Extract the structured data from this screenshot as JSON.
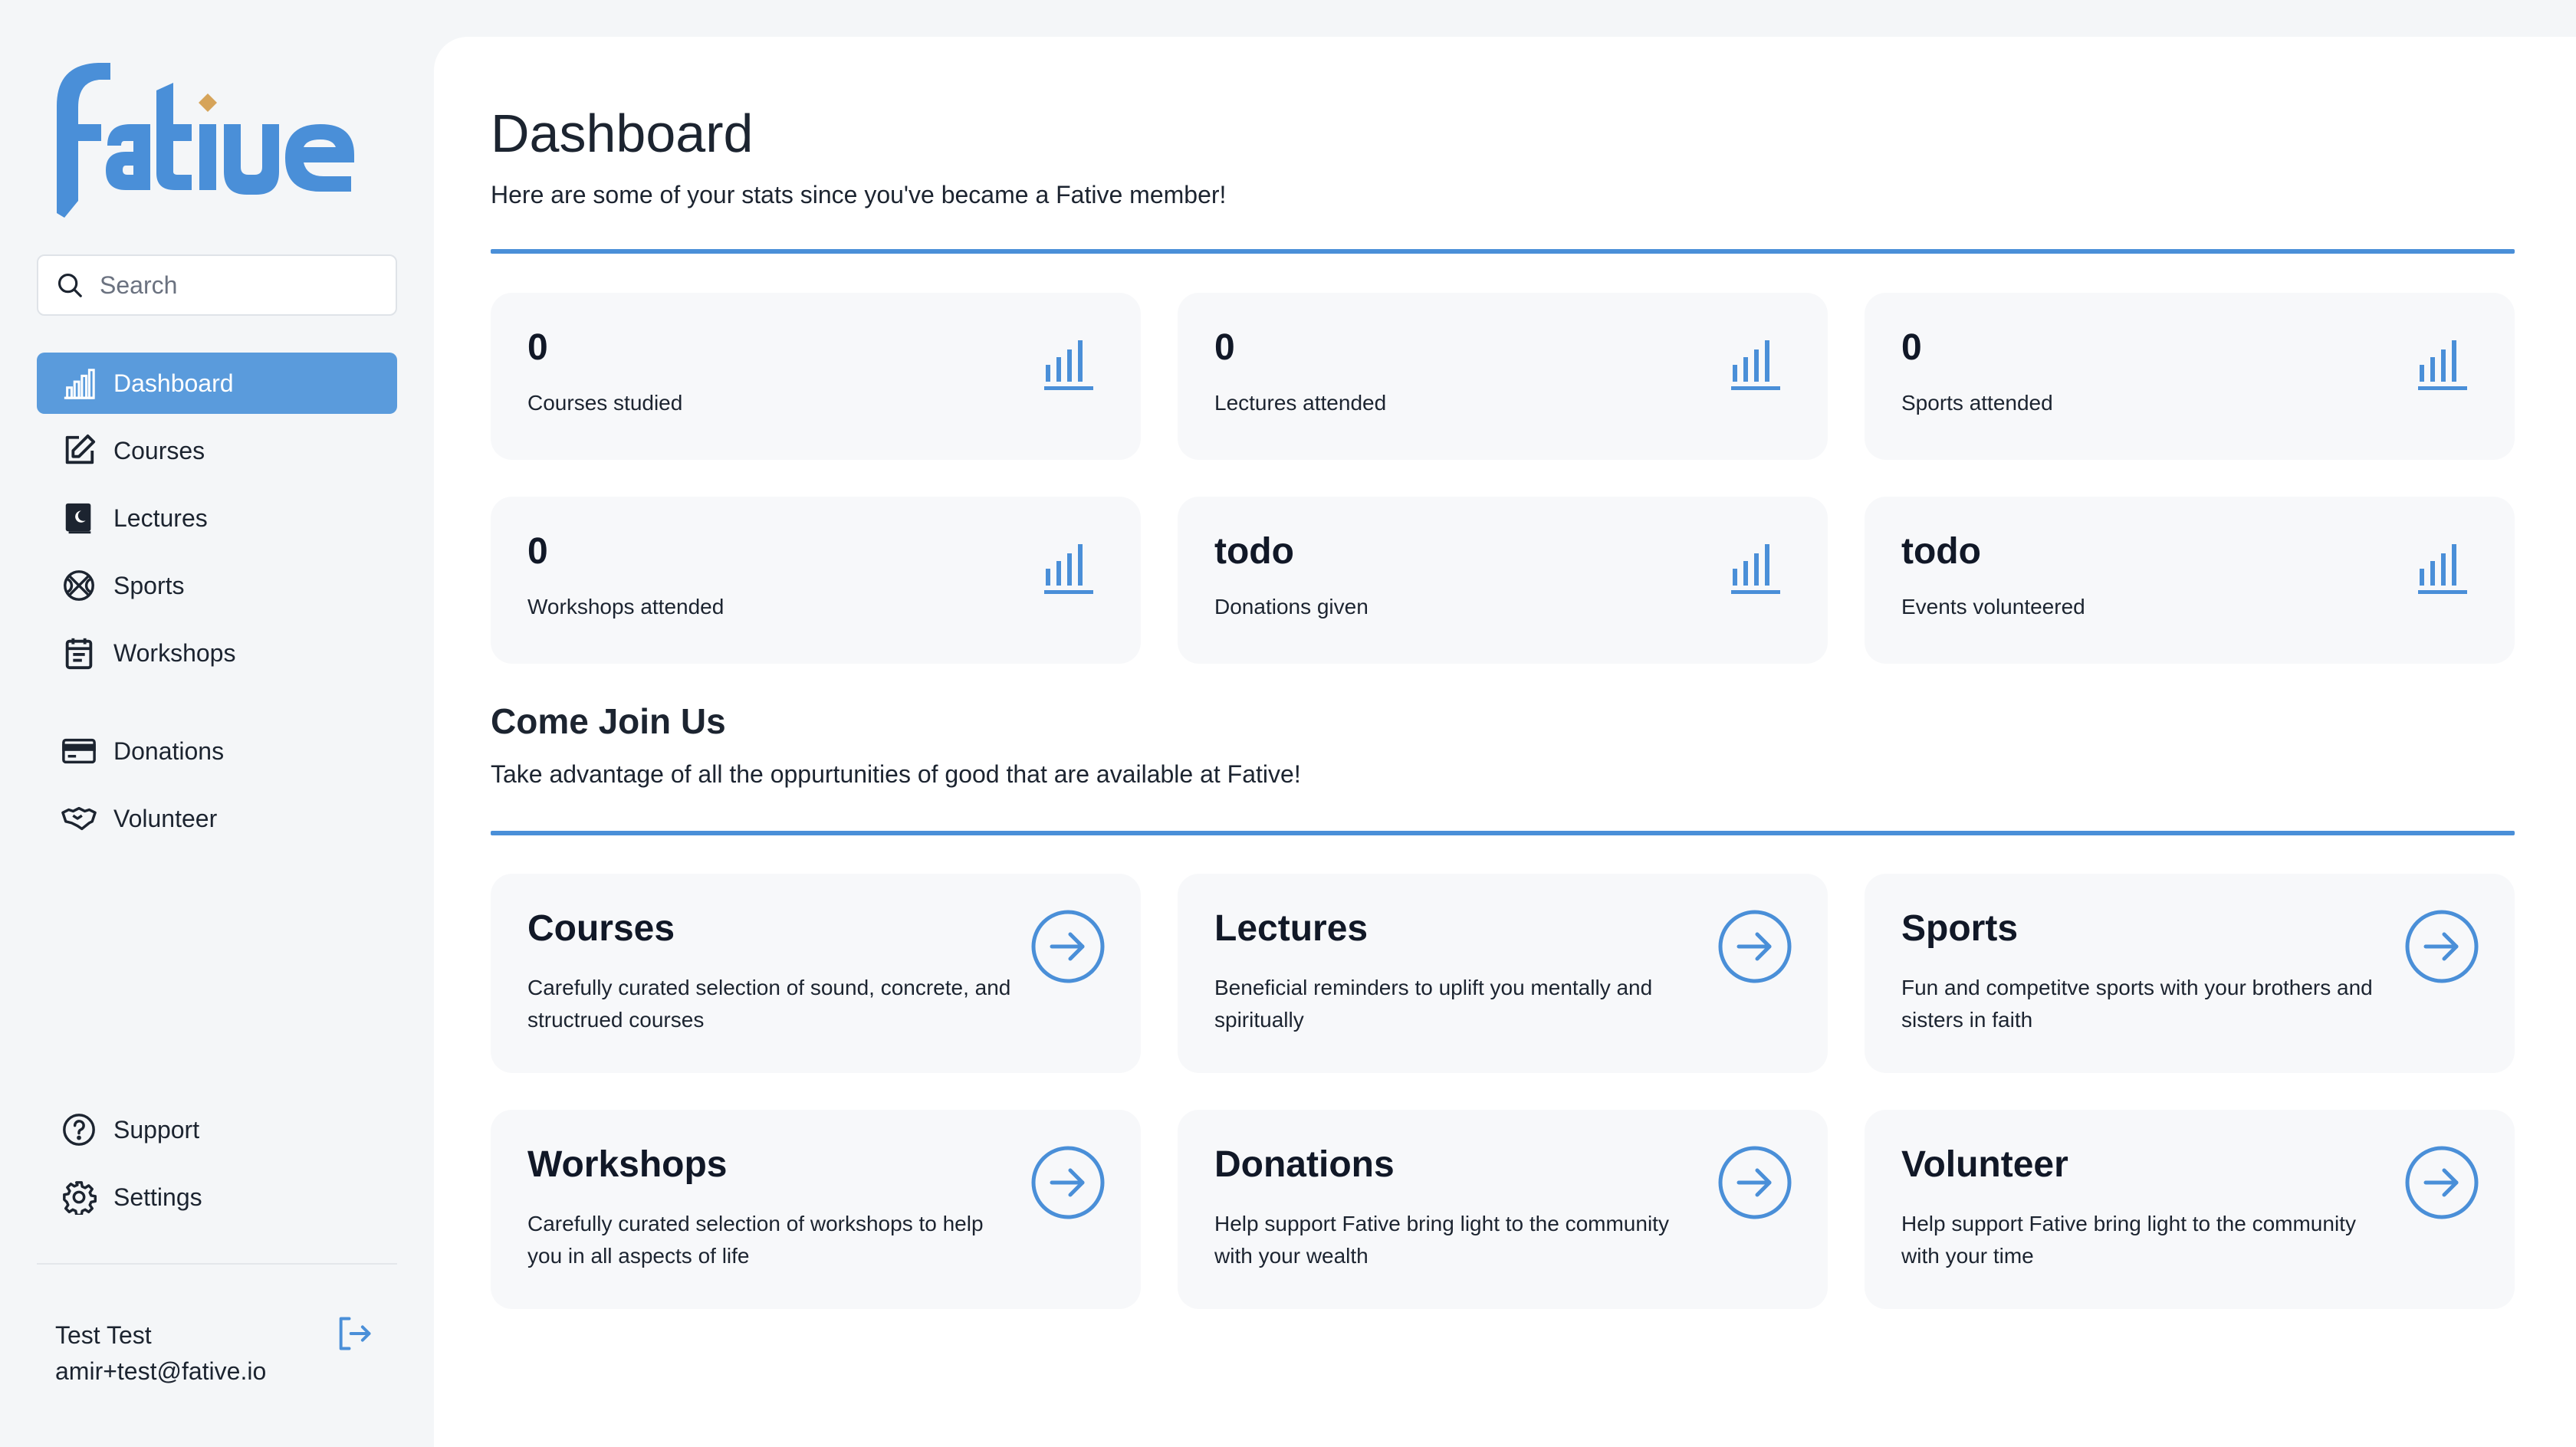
{
  "brand": {
    "logo_text": "fative",
    "accent": "#4a8fd8",
    "accent_gold": "#d6a45a"
  },
  "search": {
    "placeholder": "Search"
  },
  "nav": {
    "primary": [
      {
        "label": "Dashboard",
        "icon": "bar-chart-icon",
        "active": true
      },
      {
        "label": "Courses",
        "icon": "edit-icon"
      },
      {
        "label": "Lectures",
        "icon": "book-icon"
      },
      {
        "label": "Sports",
        "icon": "basketball-icon"
      },
      {
        "label": "Workshops",
        "icon": "calendar-icon"
      }
    ],
    "secondary": [
      {
        "label": "Donations",
        "icon": "credit-card-icon"
      },
      {
        "label": "Volunteer",
        "icon": "handshake-icon"
      }
    ],
    "bottom": [
      {
        "label": "Support",
        "icon": "help-circle-icon"
      },
      {
        "label": "Settings",
        "icon": "gear-icon"
      }
    ]
  },
  "user": {
    "name": "Test Test",
    "email": "amir+test@fative.io"
  },
  "dashboard": {
    "title": "Dashboard",
    "subtitle": "Here are some of your stats since you've became a Fative member!",
    "stats": [
      {
        "value": "0",
        "label": "Courses studied"
      },
      {
        "value": "0",
        "label": "Lectures attended"
      },
      {
        "value": "0",
        "label": "Sports attended"
      },
      {
        "value": "0",
        "label": "Workshops attended"
      },
      {
        "value": "todo",
        "label": "Donations given"
      },
      {
        "value": "todo",
        "label": "Events volunteered"
      }
    ]
  },
  "join": {
    "title": "Come Join Us",
    "subtitle": "Take advantage of all the oppurtunities of good that are available at Fative!",
    "cards": [
      {
        "title": "Courses",
        "desc": "Carefully curated selection of sound, concrete, and structrued courses"
      },
      {
        "title": "Lectures",
        "desc": "Beneficial reminders to uplift you mentally and spiritually"
      },
      {
        "title": "Sports",
        "desc": "Fun and competitve sports with your brothers and sisters in faith"
      },
      {
        "title": "Workshops",
        "desc": "Carefully curated selection of workshops to help you in all aspects of life"
      },
      {
        "title": "Donations",
        "desc": "Help support Fative bring light to the community with your wealth"
      },
      {
        "title": "Volunteer",
        "desc": "Help support Fative bring light to the community with your time"
      }
    ]
  }
}
